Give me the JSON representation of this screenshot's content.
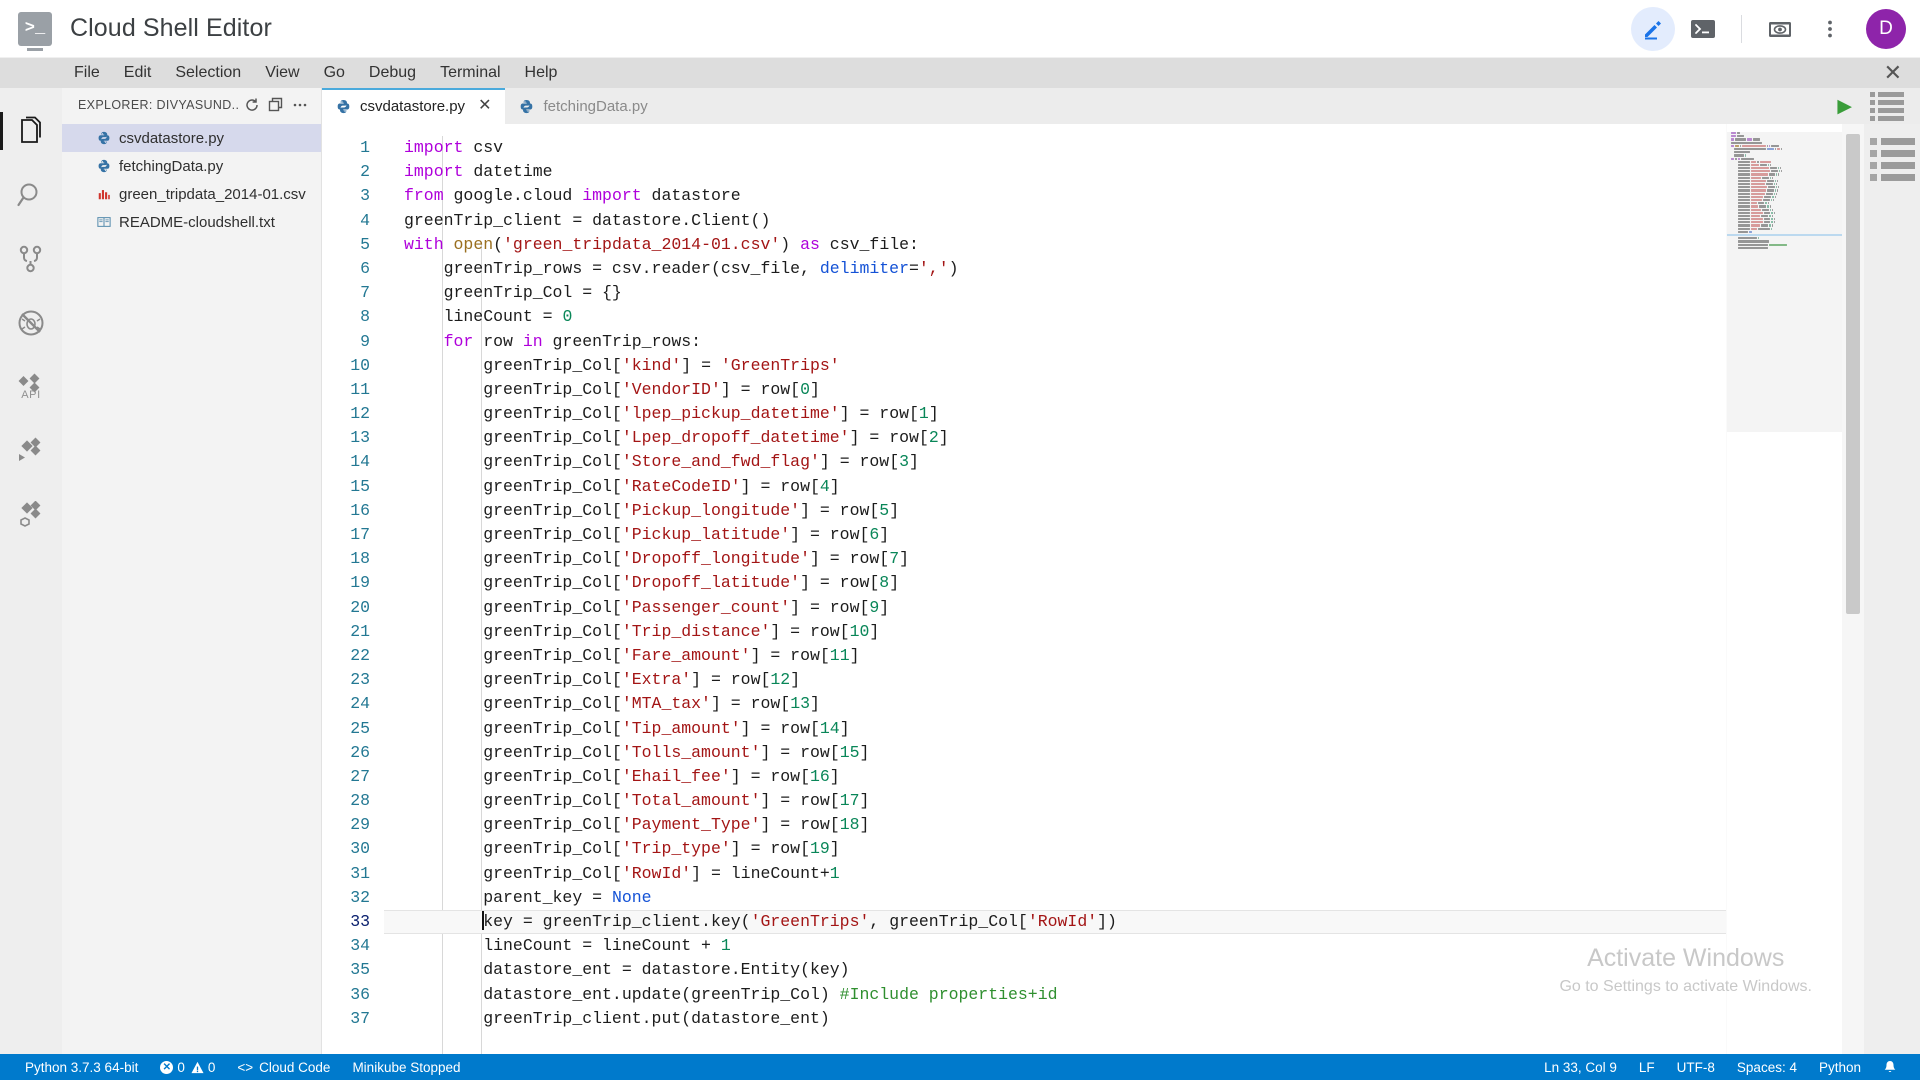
{
  "titlebar": {
    "app_title": "Cloud Shell Editor",
    "logo_glyph": ">_",
    "actions": [
      {
        "name": "editor-mode-button",
        "icon": "pencil-icon",
        "active": true
      },
      {
        "name": "terminal-button",
        "icon": "terminal-icon",
        "active": false
      },
      {
        "name": "web-preview-button",
        "icon": "web-preview-icon",
        "active": false
      },
      {
        "name": "more-options-button",
        "icon": "kebab-menu-icon",
        "active": false
      }
    ],
    "avatar_initial": "D",
    "avatar_color": "#8e24aa"
  },
  "menubar": {
    "items": [
      "File",
      "Edit",
      "Selection",
      "View",
      "Go",
      "Debug",
      "Terminal",
      "Help"
    ],
    "close_glyph": "✕"
  },
  "activitybar": {
    "items": [
      {
        "label": "Explorer",
        "icon": "files-icon",
        "selected": true
      },
      {
        "label": "Search",
        "icon": "search-icon",
        "selected": false
      },
      {
        "label": "Source Control",
        "icon": "source-control-icon",
        "selected": false
      },
      {
        "label": "Run and Debug",
        "icon": "debug-disabled-icon",
        "selected": false
      },
      {
        "label": "API",
        "icon": "api-icon",
        "selected": false,
        "text": "API"
      },
      {
        "label": "Cloud Code",
        "icon": "cloud-code-icon",
        "selected": false
      },
      {
        "label": "Cloud Code Kubernetes",
        "icon": "cloud-code-k8s-icon",
        "selected": false
      }
    ]
  },
  "sidebar": {
    "header_title": "EXPLORER: DIVYASUND...",
    "header_actions": [
      {
        "name": "refresh-explorer-button",
        "icon": "refresh-icon"
      },
      {
        "name": "collapse-all-button",
        "icon": "collapse-all-icon"
      },
      {
        "name": "explorer-more-actions-button",
        "icon": "ellipsis-icon"
      }
    ],
    "files": [
      {
        "name": "csvdatastore.py",
        "icon": "python-file-icon",
        "selected": true
      },
      {
        "name": "fetchingData.py",
        "icon": "python-file-icon",
        "selected": false
      },
      {
        "name": "green_tripdata_2014-01.csv",
        "icon": "csv-file-icon",
        "selected": false
      },
      {
        "name": "README-cloudshell.txt",
        "icon": "text-file-icon",
        "selected": false
      }
    ]
  },
  "tabs": [
    {
      "label": "csvdatastore.py",
      "icon": "python-file-icon",
      "active": true,
      "close_glyph": "✕"
    },
    {
      "label": "fetchingData.py",
      "icon": "python-file-icon",
      "active": false,
      "close_glyph": ""
    }
  ],
  "tabbar_actions": {
    "run_label": "Run",
    "run_glyph": "▶",
    "outline_label": "Open Outline"
  },
  "editor": {
    "cursor_line": 33,
    "cursor_col": 9,
    "first_line": 1,
    "code_lines": [
      {
        "n": 1,
        "tokens": [
          {
            "t": "import",
            "c": "kw"
          },
          {
            "t": " csv",
            "c": "plain"
          }
        ]
      },
      {
        "n": 2,
        "tokens": [
          {
            "t": "import",
            "c": "kw"
          },
          {
            "t": " datetime",
            "c": "plain"
          }
        ]
      },
      {
        "n": 3,
        "tokens": [
          {
            "t": "from",
            "c": "kw"
          },
          {
            "t": " google.cloud ",
            "c": "plain"
          },
          {
            "t": "import",
            "c": "kw"
          },
          {
            "t": " datastore",
            "c": "plain"
          }
        ]
      },
      {
        "n": 4,
        "tokens": [
          {
            "t": "greenTrip_client = datastore.Client()",
            "c": "plain"
          }
        ]
      },
      {
        "n": 5,
        "tokens": [
          {
            "t": "with",
            "c": "kw"
          },
          {
            "t": " ",
            "c": "plain"
          },
          {
            "t": "open",
            "c": "fn"
          },
          {
            "t": "(",
            "c": "plain"
          },
          {
            "t": "'green_tripdata_2014-01.csv'",
            "c": "str"
          },
          {
            "t": ") ",
            "c": "plain"
          },
          {
            "t": "as",
            "c": "kw"
          },
          {
            "t": " csv_file:",
            "c": "plain"
          }
        ]
      },
      {
        "n": 6,
        "tokens": [
          {
            "t": "    greenTrip_rows = csv.reader(csv_file, ",
            "c": "plain"
          },
          {
            "t": "delimiter",
            "c": "const"
          },
          {
            "t": "=",
            "c": "plain"
          },
          {
            "t": "','",
            "c": "str"
          },
          {
            "t": ")",
            "c": "plain"
          }
        ]
      },
      {
        "n": 7,
        "tokens": [
          {
            "t": "    greenTrip_Col = {}",
            "c": "plain"
          }
        ]
      },
      {
        "n": 8,
        "tokens": [
          {
            "t": "    lineCount = ",
            "c": "plain"
          },
          {
            "t": "0",
            "c": "num"
          }
        ]
      },
      {
        "n": 9,
        "tokens": [
          {
            "t": "    ",
            "c": "plain"
          },
          {
            "t": "for",
            "c": "kw"
          },
          {
            "t": " row ",
            "c": "plain"
          },
          {
            "t": "in",
            "c": "kw"
          },
          {
            "t": " greenTrip_rows:",
            "c": "plain"
          }
        ]
      },
      {
        "n": 10,
        "tokens": [
          {
            "t": "        greenTrip_Col[",
            "c": "plain"
          },
          {
            "t": "'kind'",
            "c": "str"
          },
          {
            "t": "] = ",
            "c": "plain"
          },
          {
            "t": "'GreenTrips'",
            "c": "str"
          }
        ]
      },
      {
        "n": 11,
        "tokens": [
          {
            "t": "        greenTrip_Col[",
            "c": "plain"
          },
          {
            "t": "'VendorID'",
            "c": "str"
          },
          {
            "t": "] = row[",
            "c": "plain"
          },
          {
            "t": "0",
            "c": "num"
          },
          {
            "t": "]",
            "c": "plain"
          }
        ]
      },
      {
        "n": 12,
        "tokens": [
          {
            "t": "        greenTrip_Col[",
            "c": "plain"
          },
          {
            "t": "'lpep_pickup_datetime'",
            "c": "str"
          },
          {
            "t": "] = row[",
            "c": "plain"
          },
          {
            "t": "1",
            "c": "num"
          },
          {
            "t": "]",
            "c": "plain"
          }
        ]
      },
      {
        "n": 13,
        "tokens": [
          {
            "t": "        greenTrip_Col[",
            "c": "plain"
          },
          {
            "t": "'Lpep_dropoff_datetime'",
            "c": "str"
          },
          {
            "t": "] = row[",
            "c": "plain"
          },
          {
            "t": "2",
            "c": "num"
          },
          {
            "t": "]",
            "c": "plain"
          }
        ]
      },
      {
        "n": 14,
        "tokens": [
          {
            "t": "        greenTrip_Col[",
            "c": "plain"
          },
          {
            "t": "'Store_and_fwd_flag'",
            "c": "str"
          },
          {
            "t": "] = row[",
            "c": "plain"
          },
          {
            "t": "3",
            "c": "num"
          },
          {
            "t": "]",
            "c": "plain"
          }
        ]
      },
      {
        "n": 15,
        "tokens": [
          {
            "t": "        greenTrip_Col[",
            "c": "plain"
          },
          {
            "t": "'RateCodeID'",
            "c": "str"
          },
          {
            "t": "] = row[",
            "c": "plain"
          },
          {
            "t": "4",
            "c": "num"
          },
          {
            "t": "]",
            "c": "plain"
          }
        ]
      },
      {
        "n": 16,
        "tokens": [
          {
            "t": "        greenTrip_Col[",
            "c": "plain"
          },
          {
            "t": "'Pickup_longitude'",
            "c": "str"
          },
          {
            "t": "] = row[",
            "c": "plain"
          },
          {
            "t": "5",
            "c": "num"
          },
          {
            "t": "]",
            "c": "plain"
          }
        ]
      },
      {
        "n": 17,
        "tokens": [
          {
            "t": "        greenTrip_Col[",
            "c": "plain"
          },
          {
            "t": "'Pickup_latitude'",
            "c": "str"
          },
          {
            "t": "] = row[",
            "c": "plain"
          },
          {
            "t": "6",
            "c": "num"
          },
          {
            "t": "]",
            "c": "plain"
          }
        ]
      },
      {
        "n": 18,
        "tokens": [
          {
            "t": "        greenTrip_Col[",
            "c": "plain"
          },
          {
            "t": "'Dropoff_longitude'",
            "c": "str"
          },
          {
            "t": "] = row[",
            "c": "plain"
          },
          {
            "t": "7",
            "c": "num"
          },
          {
            "t": "]",
            "c": "plain"
          }
        ]
      },
      {
        "n": 19,
        "tokens": [
          {
            "t": "        greenTrip_Col[",
            "c": "plain"
          },
          {
            "t": "'Dropoff_latitude'",
            "c": "str"
          },
          {
            "t": "] = row[",
            "c": "plain"
          },
          {
            "t": "8",
            "c": "num"
          },
          {
            "t": "]",
            "c": "plain"
          }
        ]
      },
      {
        "n": 20,
        "tokens": [
          {
            "t": "        greenTrip_Col[",
            "c": "plain"
          },
          {
            "t": "'Passenger_count'",
            "c": "str"
          },
          {
            "t": "] = row[",
            "c": "plain"
          },
          {
            "t": "9",
            "c": "num"
          },
          {
            "t": "]",
            "c": "plain"
          }
        ]
      },
      {
        "n": 21,
        "tokens": [
          {
            "t": "        greenTrip_Col[",
            "c": "plain"
          },
          {
            "t": "'Trip_distance'",
            "c": "str"
          },
          {
            "t": "] = row[",
            "c": "plain"
          },
          {
            "t": "10",
            "c": "num"
          },
          {
            "t": "]",
            "c": "plain"
          }
        ]
      },
      {
        "n": 22,
        "tokens": [
          {
            "t": "        greenTrip_Col[",
            "c": "plain"
          },
          {
            "t": "'Fare_amount'",
            "c": "str"
          },
          {
            "t": "] = row[",
            "c": "plain"
          },
          {
            "t": "11",
            "c": "num"
          },
          {
            "t": "]",
            "c": "plain"
          }
        ]
      },
      {
        "n": 23,
        "tokens": [
          {
            "t": "        greenTrip_Col[",
            "c": "plain"
          },
          {
            "t": "'Extra'",
            "c": "str"
          },
          {
            "t": "] = row[",
            "c": "plain"
          },
          {
            "t": "12",
            "c": "num"
          },
          {
            "t": "]",
            "c": "plain"
          }
        ]
      },
      {
        "n": 24,
        "tokens": [
          {
            "t": "        greenTrip_Col[",
            "c": "plain"
          },
          {
            "t": "'MTA_tax'",
            "c": "str"
          },
          {
            "t": "] = row[",
            "c": "plain"
          },
          {
            "t": "13",
            "c": "num"
          },
          {
            "t": "]",
            "c": "plain"
          }
        ]
      },
      {
        "n": 25,
        "tokens": [
          {
            "t": "        greenTrip_Col[",
            "c": "plain"
          },
          {
            "t": "'Tip_amount'",
            "c": "str"
          },
          {
            "t": "] = row[",
            "c": "plain"
          },
          {
            "t": "14",
            "c": "num"
          },
          {
            "t": "]",
            "c": "plain"
          }
        ]
      },
      {
        "n": 26,
        "tokens": [
          {
            "t": "        greenTrip_Col[",
            "c": "plain"
          },
          {
            "t": "'Tolls_amount'",
            "c": "str"
          },
          {
            "t": "] = row[",
            "c": "plain"
          },
          {
            "t": "15",
            "c": "num"
          },
          {
            "t": "]",
            "c": "plain"
          }
        ]
      },
      {
        "n": 27,
        "tokens": [
          {
            "t": "        greenTrip_Col[",
            "c": "plain"
          },
          {
            "t": "'Ehail_fee'",
            "c": "str"
          },
          {
            "t": "] = row[",
            "c": "plain"
          },
          {
            "t": "16",
            "c": "num"
          },
          {
            "t": "]",
            "c": "plain"
          }
        ]
      },
      {
        "n": 28,
        "tokens": [
          {
            "t": "        greenTrip_Col[",
            "c": "plain"
          },
          {
            "t": "'Total_amount'",
            "c": "str"
          },
          {
            "t": "] = row[",
            "c": "plain"
          },
          {
            "t": "17",
            "c": "num"
          },
          {
            "t": "]",
            "c": "plain"
          }
        ]
      },
      {
        "n": 29,
        "tokens": [
          {
            "t": "        greenTrip_Col[",
            "c": "plain"
          },
          {
            "t": "'Payment_Type'",
            "c": "str"
          },
          {
            "t": "] = row[",
            "c": "plain"
          },
          {
            "t": "18",
            "c": "num"
          },
          {
            "t": "]",
            "c": "plain"
          }
        ]
      },
      {
        "n": 30,
        "tokens": [
          {
            "t": "        greenTrip_Col[",
            "c": "plain"
          },
          {
            "t": "'Trip_type'",
            "c": "str"
          },
          {
            "t": "] = row[",
            "c": "plain"
          },
          {
            "t": "19",
            "c": "num"
          },
          {
            "t": "]",
            "c": "plain"
          }
        ]
      },
      {
        "n": 31,
        "tokens": [
          {
            "t": "        greenTrip_Col[",
            "c": "plain"
          },
          {
            "t": "'RowId'",
            "c": "str"
          },
          {
            "t": "] = lineCount+",
            "c": "plain"
          },
          {
            "t": "1",
            "c": "num"
          }
        ]
      },
      {
        "n": 32,
        "tokens": [
          {
            "t": "        parent_key = ",
            "c": "plain"
          },
          {
            "t": "None",
            "c": "const"
          }
        ]
      },
      {
        "n": 33,
        "tokens": [
          {
            "t": "        ",
            "c": "plain"
          },
          {
            "t": "|CURSOR|",
            "c": "cursor"
          },
          {
            "t": "key = greenTrip_client.key(",
            "c": "plain"
          },
          {
            "t": "'GreenTrips'",
            "c": "str"
          },
          {
            "t": ", greenTrip_Col[",
            "c": "plain"
          },
          {
            "t": "'RowId'",
            "c": "str"
          },
          {
            "t": "])",
            "c": "plain"
          }
        ],
        "current": true
      },
      {
        "n": 34,
        "tokens": [
          {
            "t": "        lineCount = lineCount + ",
            "c": "plain"
          },
          {
            "t": "1",
            "c": "num"
          }
        ]
      },
      {
        "n": 35,
        "tokens": [
          {
            "t": "        datastore_ent = datastore.Entity(key)",
            "c": "plain"
          }
        ]
      },
      {
        "n": 36,
        "tokens": [
          {
            "t": "        datastore_ent.update(greenTrip_Col) ",
            "c": "plain"
          },
          {
            "t": "#Include properties+id",
            "c": "cmt"
          }
        ]
      },
      {
        "n": 37,
        "tokens": [
          {
            "t": "        greenTrip_client.put(datastore_ent)",
            "c": "plain"
          }
        ]
      }
    ]
  },
  "watermark": {
    "title": "Activate Windows",
    "subtitle": "Go to Settings to activate Windows."
  },
  "statusbar": {
    "left": [
      {
        "name": "python-interpreter-status",
        "label": "Python 3.7.3 64-bit"
      },
      {
        "name": "problems-status",
        "label": "0",
        "label2": "0",
        "icon": "error-icon",
        "icon2": "warning-icon"
      },
      {
        "name": "cloud-code-status",
        "label": "Cloud Code",
        "icon": "code-brackets-icon"
      },
      {
        "name": "minikube-status",
        "label": "Minikube Stopped"
      }
    ],
    "right": [
      {
        "name": "cursor-position-status",
        "label": "Ln 33, Col 9"
      },
      {
        "name": "eol-status",
        "label": "LF"
      },
      {
        "name": "encoding-status",
        "label": "UTF-8"
      },
      {
        "name": "indentation-status",
        "label": "Spaces: 4"
      },
      {
        "name": "language-mode-status",
        "label": "Python"
      },
      {
        "name": "notifications-status",
        "label": "🔔",
        "icon": "bell-icon"
      }
    ],
    "background": "#007acc"
  }
}
